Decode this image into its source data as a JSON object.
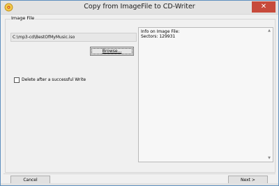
{
  "window": {
    "title": "Copy from ImageFile to CD-Writer",
    "close_glyph": "✕"
  },
  "image_group": {
    "label": "Image File",
    "path_value": "C:\\mp3-cd\\BestOfMyMusic.iso",
    "browse_label": "Browse...",
    "delete_checkbox_label": "Delete after a successful Write",
    "delete_checked": false
  },
  "info": {
    "line1": "Info on Image File:",
    "line2": "Sectors: 129931"
  },
  "footer": {
    "cancel_label": "Cancel",
    "next_label": "Next >"
  },
  "icons": {
    "app": "cd-writer-icon",
    "close": "close-icon"
  }
}
